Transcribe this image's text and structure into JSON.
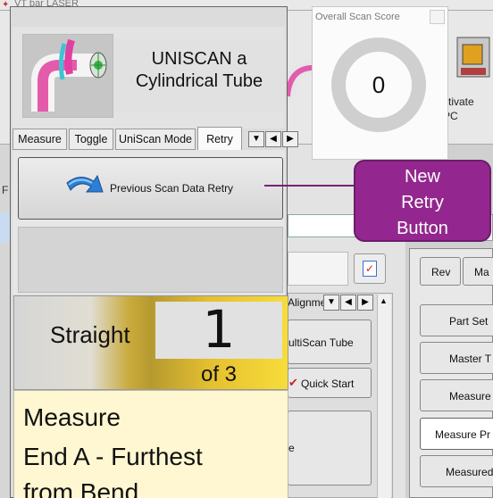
{
  "background_app": {
    "title": "VT bar LASER",
    "left_strip_label": "F",
    "activate_label_1": "ctivate",
    "activate_label_2": "PC",
    "alignment_tab": "Alignme",
    "multiscan_label": "ultiScan Tube",
    "quick_start_label": "Quick Start",
    "e_label": "e",
    "rev_label": "Rev",
    "ma_label": "Ma",
    "side_buttons": [
      "Part Set",
      "Master T",
      "Measure S",
      "Measure Pr",
      "Measured"
    ]
  },
  "score_widget": {
    "title": "Overall Scan Score",
    "value": "0"
  },
  "panel": {
    "title_line1": "UNISCAN a",
    "title_line2": "Cylindrical Tube",
    "tabs": [
      {
        "label": "Measure"
      },
      {
        "label": "Toggle"
      },
      {
        "label": "UniScan Mode"
      },
      {
        "label": "Retry"
      }
    ],
    "active_tab": "Retry",
    "retry_button_label": "Previous Scan Data Retry",
    "status_label": "Straight",
    "count_current": "1",
    "count_total_label": "of 3",
    "instruction_lines": [
      "Measure",
      "End A - Furthest",
      "from Bend"
    ]
  },
  "callout": {
    "lines": [
      "New",
      "Retry",
      "Button"
    ]
  },
  "colors": {
    "callout_bg": "#93278f",
    "instruction_bg": "#fff7d1",
    "status_gold": "#e5c030"
  }
}
